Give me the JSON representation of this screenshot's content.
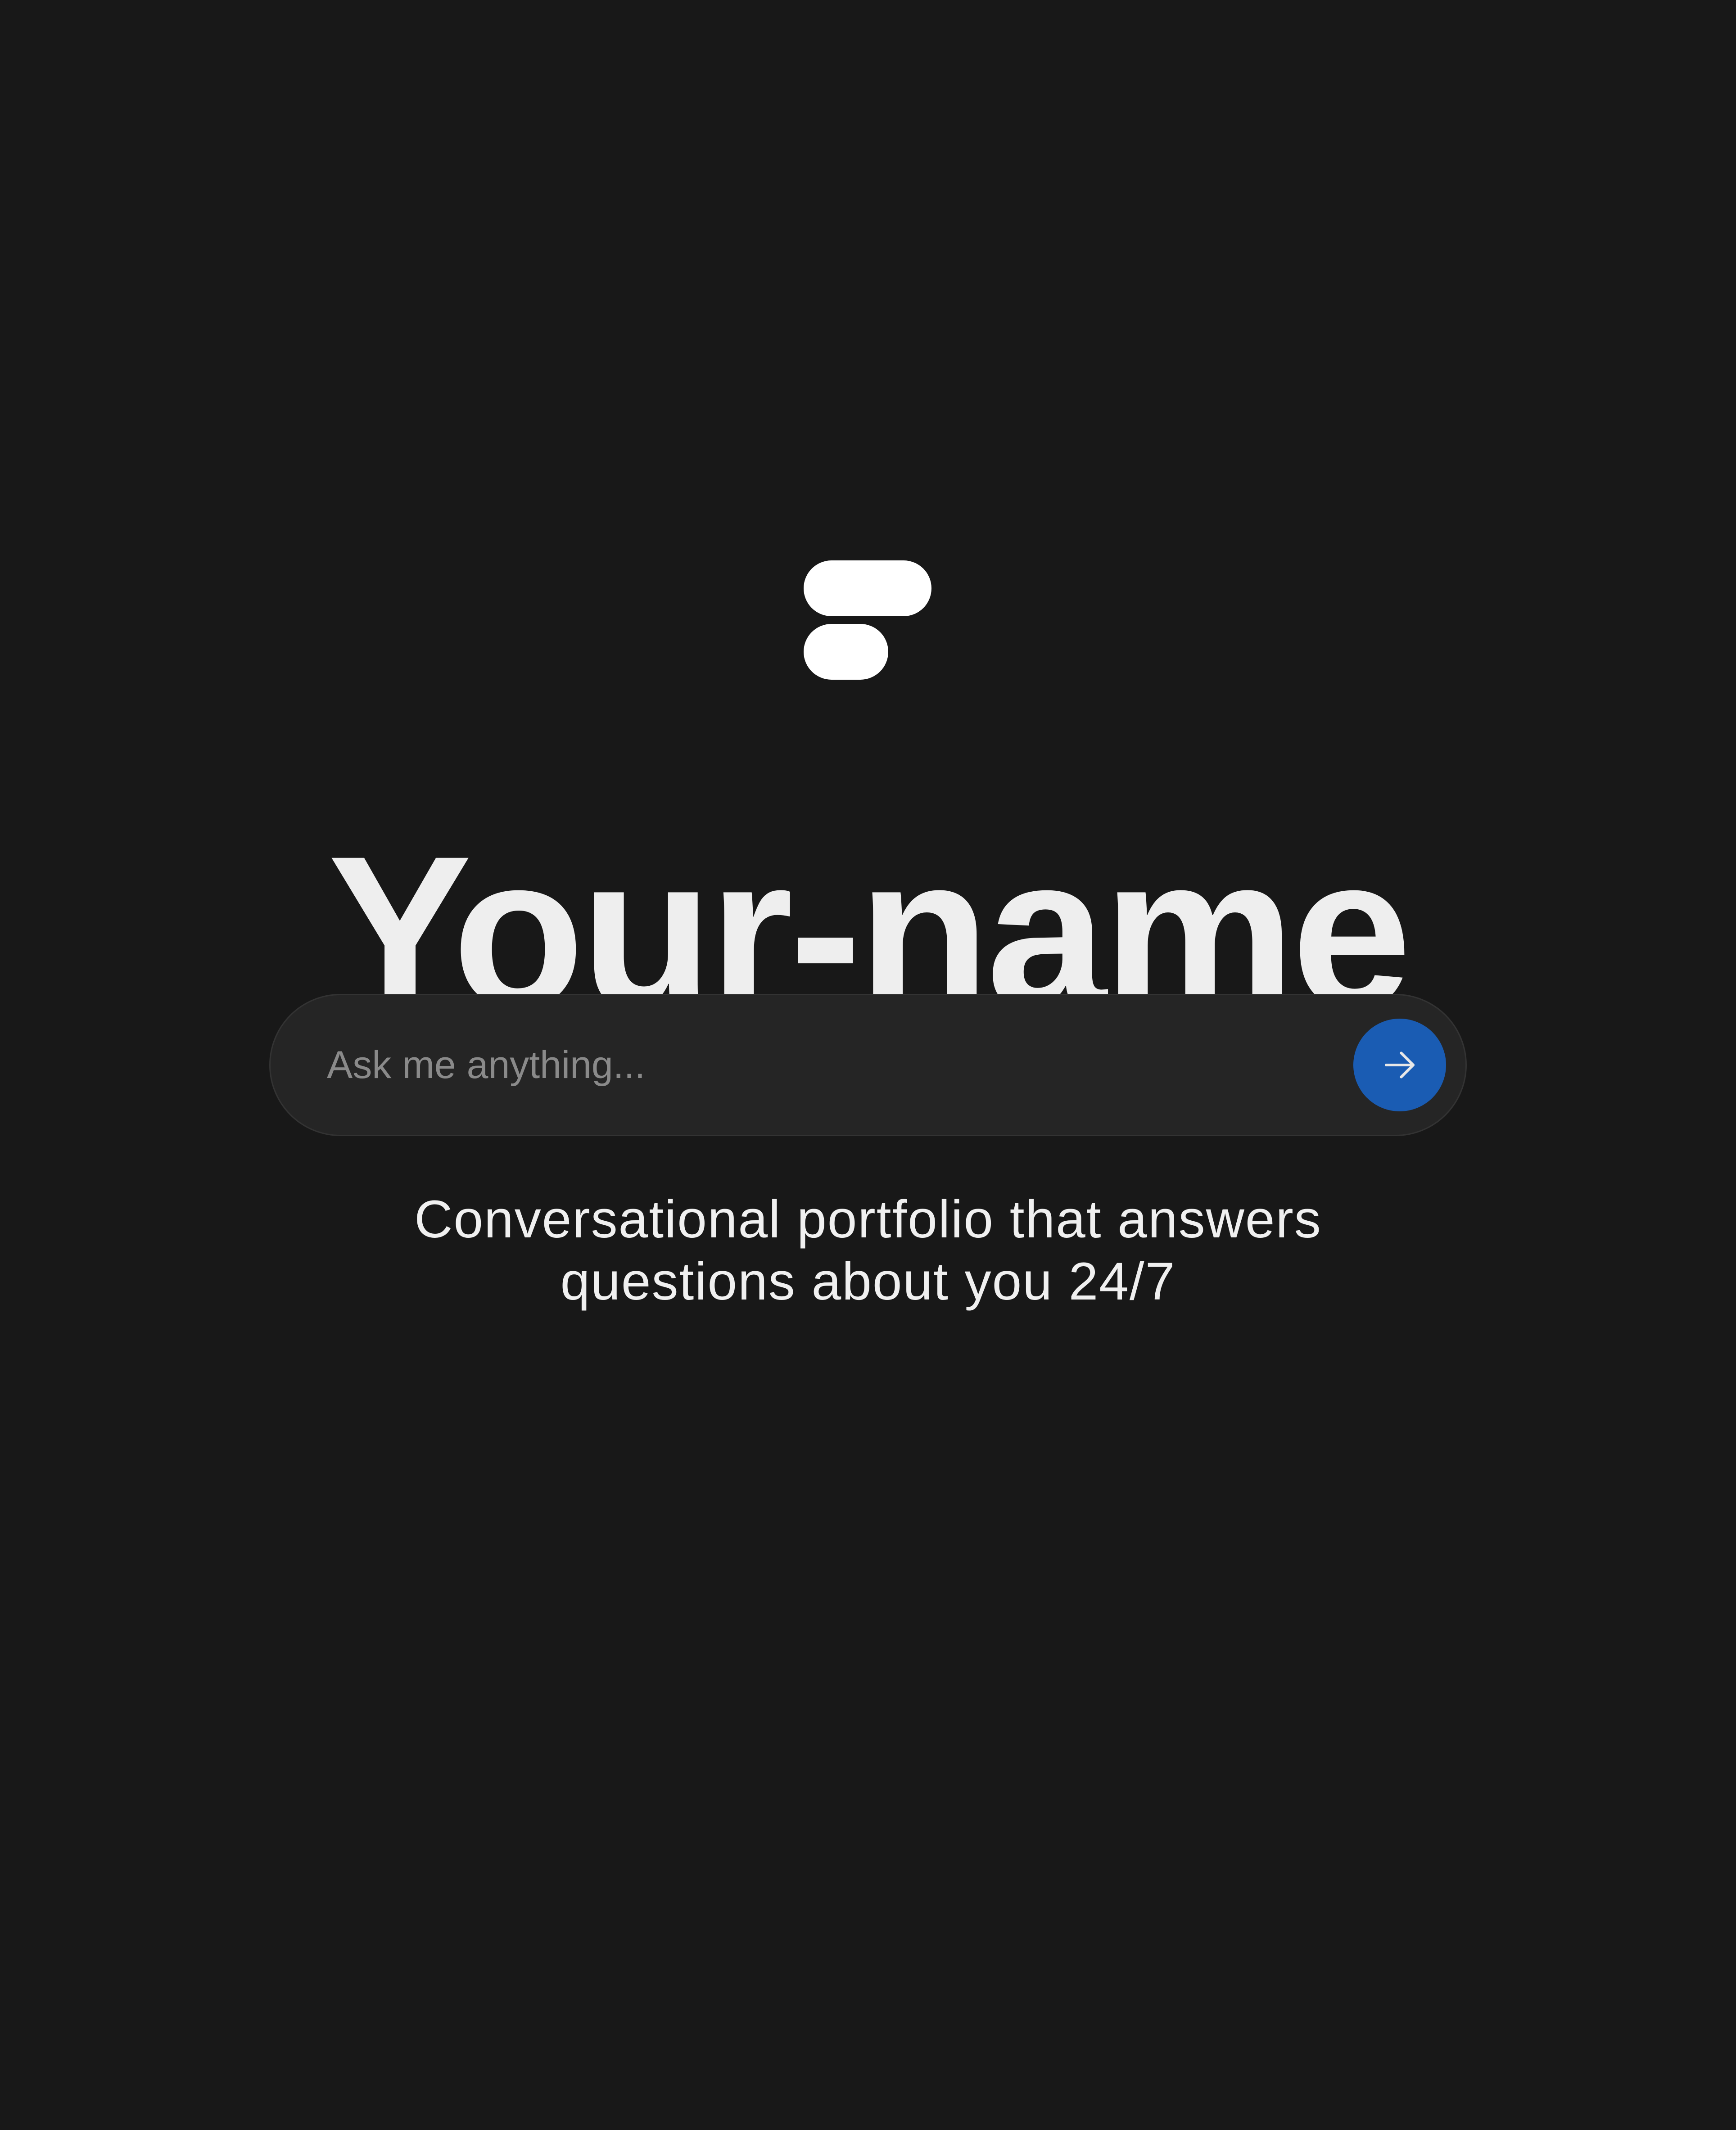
{
  "logo": {
    "icon": "stacked-pills-logo-icon",
    "color": "#ffffff"
  },
  "hero": {
    "title": "Your-name"
  },
  "search": {
    "placeholder": "Ask me anything...",
    "value": "",
    "submit_icon": "arrow-right-icon",
    "submit_color": "#1a5cb3"
  },
  "tagline": {
    "line1": "Conversational portfolio that answers",
    "line2": "questions about you 24/7"
  },
  "colors": {
    "background": "#181818",
    "search_background": "#252525",
    "accent": "#1a5cb3",
    "text": "#eeeeee"
  }
}
